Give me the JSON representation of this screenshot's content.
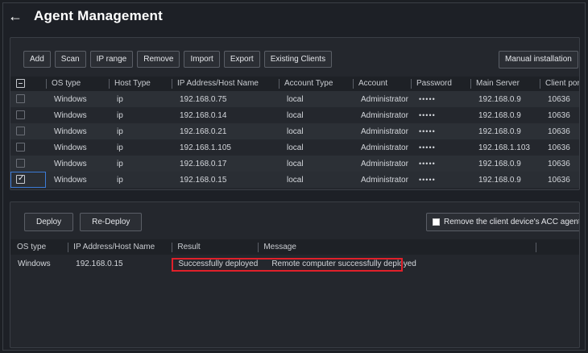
{
  "header": {
    "title": "Agent Management",
    "back_icon": "back-arrow-icon"
  },
  "toolbar": {
    "buttons": [
      "Add",
      "Scan",
      "IP range",
      "Remove",
      "Import",
      "Export",
      "Existing Clients"
    ],
    "manual_label": "Manual installation"
  },
  "agents_table": {
    "columns": [
      "OS type",
      "Host Type",
      "IP Address/Host Name",
      "Account Type",
      "Account",
      "Password",
      "Main Server",
      "Client por"
    ],
    "rows": [
      {
        "os": "Windows",
        "host_type": "ip",
        "ip": "192.168.0.75",
        "account_type": "local",
        "account": "Administrator",
        "password": "•••••",
        "main_server": "192.168.0.9",
        "client_port": "10636",
        "checked": false
      },
      {
        "os": "Windows",
        "host_type": "ip",
        "ip": "192.168.0.14",
        "account_type": "local",
        "account": "Administrator",
        "password": "•••••",
        "main_server": "192.168.0.9",
        "client_port": "10636",
        "checked": false
      },
      {
        "os": "Windows",
        "host_type": "ip",
        "ip": "192.168.0.21",
        "account_type": "local",
        "account": "Administrator",
        "password": "•••••",
        "main_server": "192.168.0.9",
        "client_port": "10636",
        "checked": false
      },
      {
        "os": "Windows",
        "host_type": "ip",
        "ip": "192.168.1.105",
        "account_type": "local",
        "account": "Administrator",
        "password": "•••••",
        "main_server": "192.168.1.103",
        "client_port": "10636",
        "checked": false
      },
      {
        "os": "Windows",
        "host_type": "ip",
        "ip": "192.168.0.17",
        "account_type": "local",
        "account": "Administrator",
        "password": "•••••",
        "main_server": "192.168.0.9",
        "client_port": "10636",
        "checked": false
      },
      {
        "os": "Windows",
        "host_type": "ip",
        "ip": "192.168.0.15",
        "account_type": "local",
        "account": "Administrator",
        "password": "•••••",
        "main_server": "192.168.0.9",
        "client_port": "10636",
        "checked": true
      }
    ]
  },
  "deploy": {
    "deploy_label": "Deploy",
    "redeploy_label": "Re-Deploy",
    "remove_agent_label": "Remove the client device's ACC agent"
  },
  "results_table": {
    "columns": [
      "OS type",
      "IP Address/Host Name",
      "Result",
      "Message"
    ],
    "rows": [
      {
        "os": "Windows",
        "ip": "192.168.0.15",
        "result": "Successfully deployed",
        "message": "Remote computer successfully deployed"
      }
    ]
  },
  "colors": {
    "highlight": "#e0202a",
    "selection": "#3c7bd6"
  }
}
